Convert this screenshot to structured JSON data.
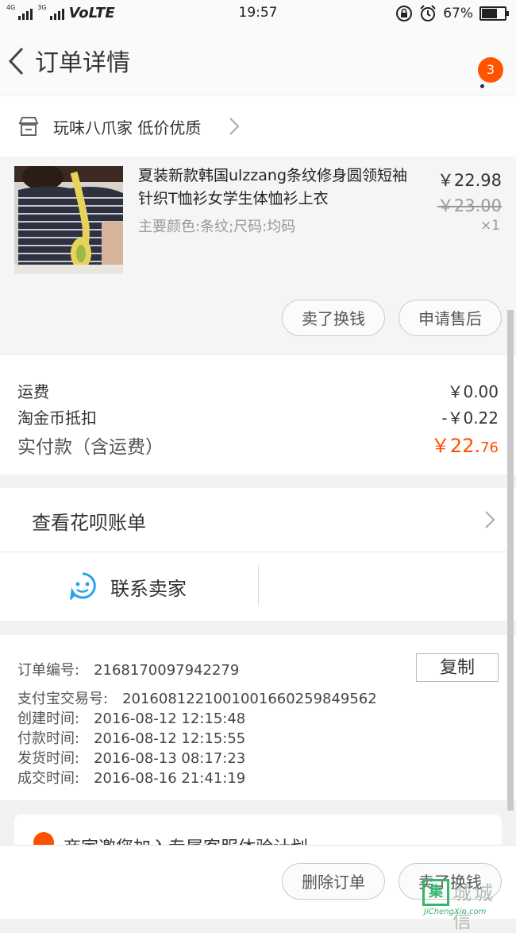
{
  "status_bar": {
    "net_left": "4G",
    "net_right": "3G",
    "volte": "VoLTE",
    "time": "19:57",
    "battery": "67%"
  },
  "nav": {
    "title": "订单详情",
    "badge_count": "3"
  },
  "shop": {
    "name": "玩味八爪家 低价优质"
  },
  "product": {
    "title": "夏装新款韩国ulzzang条纹修身圆领短袖针织T恤衫女学生体恤衫上衣",
    "spec": "主要颜色:条纹;尺码:均码",
    "price": "￥22.98",
    "original_price": "￥23.00",
    "quantity": "×1",
    "actions": [
      "卖了换钱",
      "申请售后"
    ]
  },
  "fees": {
    "shipping_label": "运费",
    "shipping_value": "￥0.00",
    "coin_label": "淘金币抵扣",
    "coin_value": "-￥0.22",
    "paid_label": "实付款（含运费）",
    "paid_symbol": "￥",
    "paid_int": "22.",
    "paid_dec": "76"
  },
  "huabei": {
    "label": "查看花呗账单"
  },
  "contact": {
    "label": "联系卖家"
  },
  "order_info": {
    "copy_label": "复制",
    "lines": [
      {
        "label": "订单编号:",
        "value": "2168170097942279"
      },
      {
        "label": "支付宝交易号:",
        "value": "2016081221001001660259849562"
      },
      {
        "label": "创建时间:",
        "value": "2016-08-12 12:15:48"
      },
      {
        "label": "付款时间:",
        "value": "2016-08-12 12:15:55"
      },
      {
        "label": "发货时间:",
        "value": "2016-08-13 08:17:23"
      },
      {
        "label": "成交时间:",
        "value": "2016-08-16 21:41:19"
      }
    ]
  },
  "promo": {
    "text": "商家邀您加入专属客服体验计划"
  },
  "bottom_bar": {
    "buttons": [
      "删除订单",
      "卖了换钱"
    ]
  },
  "watermark": {
    "logo": "集",
    "cn": "城城信",
    "en": "JiChengXin.com"
  },
  "colors": {
    "accent": "#ff5000",
    "badge": "#ff5500",
    "contact_icon": "#29a3ef",
    "watermark": "#36b66c"
  }
}
